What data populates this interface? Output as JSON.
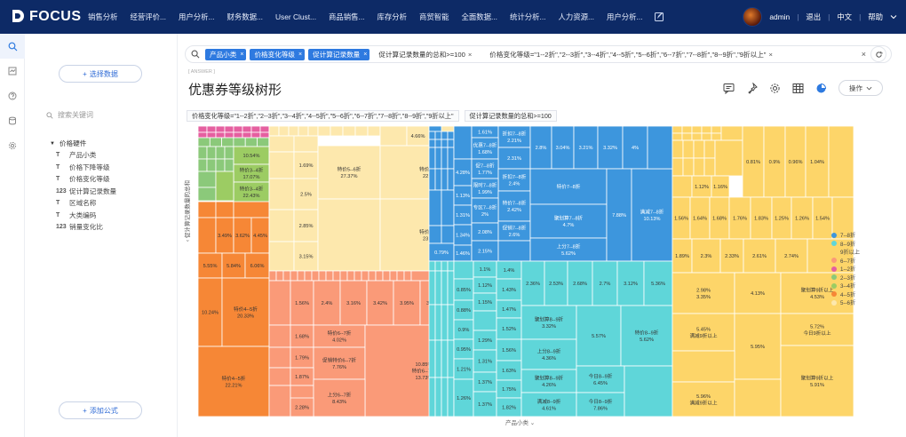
{
  "app": {
    "brand": "FOCUS"
  },
  "nav": {
    "items": [
      "销售分析",
      "经营评价...",
      "用户分析...",
      "财务数据...",
      "User Clust...",
      "商品销售...",
      "库存分析",
      "商贸智能",
      "全面数据...",
      "统计分析...",
      "人力资源...",
      "用户分析..."
    ],
    "user": "admin",
    "logout": "退出",
    "lang": "中文",
    "help": "帮助"
  },
  "sidebar": {
    "pick_data": "选择数据",
    "search_placeholder": "搜索关键词",
    "group": "价格硬件",
    "fields": [
      {
        "type": "T",
        "name": "产品小类"
      },
      {
        "type": "T",
        "name": "价格下降等级"
      },
      {
        "type": "T",
        "name": "价格变化等级"
      },
      {
        "type": "123",
        "name": "促计算记录数量"
      },
      {
        "type": "T",
        "name": "区域名称"
      },
      {
        "type": "T",
        "name": "大类编码"
      },
      {
        "type": "123",
        "name": "销量变化比"
      }
    ],
    "add_formula": "添加公式"
  },
  "filterbar": {
    "chips": [
      "产品小类",
      "价格变化等级",
      "促计算记录数量"
    ],
    "cond1": "促计算记录数量的总和>=100",
    "cond2": "价格变化等级=\"1--2折\",\"2--3折\",\"3--4折\",\"4--5折\",\"5--6折\",\"6--7折\",\"7--8折\",\"8--9折\",\"9折以上\""
  },
  "page": {
    "subtag": "[ ANSWER ]",
    "title": "优惠券等级树形",
    "op_button": "操作"
  },
  "conditions": [
    "价格变化等级=\"1--2折\",\"2--3折\",\"3--4折\",\"4--5折\",\"5--6折\",\"6--7折\",\"7--8折\",\"8--9折\",\"9折以上\"",
    "促计算记录数量的总和>=100"
  ],
  "chart_data": {
    "type": "treemap",
    "y_axis_label": "促计算记录数量的总和",
    "x_axis_label": "产品小类",
    "legend": [
      {
        "name": "7--8折",
        "color": "#3d96dd"
      },
      {
        "name": "8--9折",
        "color": "#5fd6d9"
      },
      {
        "name": "9折以上",
        "color": "#fdd569"
      },
      {
        "name": "6--7折",
        "color": "#fa9a78"
      },
      {
        "name": "1--2折",
        "color": "#e55fa0"
      },
      {
        "name": "2--3折",
        "color": "#8bc97a"
      },
      {
        "name": "3--4折",
        "color": "#9ccc63"
      },
      {
        "name": "4--5折",
        "color": "#f68736"
      },
      {
        "name": "5--6折",
        "color": "#fde8ad"
      }
    ],
    "labels": [
      {
        "text": "10.54%"
      },
      {
        "text": "特价3--4折"
      },
      {
        "text": "17.07%"
      },
      {
        "text": "特价3--4折"
      },
      {
        "text": "22.43%"
      },
      {
        "text": "3.49%"
      },
      {
        "text": "3.62%"
      },
      {
        "text": "4.45%"
      },
      {
        "text": "5.55%"
      },
      {
        "text": "5.84%"
      },
      {
        "text": "6.06%"
      },
      {
        "text": "10.24%"
      },
      {
        "text": "特价4--5折"
      },
      {
        "text": "20.33%"
      },
      {
        "text": "特价4--5折"
      },
      {
        "text": "22.21%"
      },
      {
        "text": "4.66%"
      },
      {
        "text": "4.61%"
      },
      {
        "text": "5.08%"
      },
      {
        "text": "1.69%"
      },
      {
        "text": "2.5%"
      },
      {
        "text": "2.85%"
      },
      {
        "text": "3.15%"
      },
      {
        "text": "特价5--6折"
      },
      {
        "text": "27.37%"
      },
      {
        "text": "特价5--6折"
      },
      {
        "text": "22.40%"
      },
      {
        "text": "特价5--6折"
      },
      {
        "text": "23.86%"
      },
      {
        "text": "1.56%"
      },
      {
        "text": "2.4%"
      },
      {
        "text": "3.16%"
      },
      {
        "text": "3.42%"
      },
      {
        "text": "3.95%"
      },
      {
        "text": "3.96%"
      },
      {
        "text": "1.68%"
      },
      {
        "text": "特价6--7折"
      },
      {
        "text": "4.02%"
      },
      {
        "text": "1.79%"
      },
      {
        "text": "促销特价6--7折"
      },
      {
        "text": "7.76%"
      },
      {
        "text": "1.87%"
      },
      {
        "text": "10.85%"
      },
      {
        "text": "特价6--7折"
      },
      {
        "text": "13.73%"
      },
      {
        "text": "2.13%"
      },
      {
        "text": "上分6--7折"
      },
      {
        "text": "8.43%"
      },
      {
        "text": "2.28%"
      },
      {
        "text": "1.61%"
      },
      {
        "text": "折扣7--8折"
      },
      {
        "text": "2.21%"
      },
      {
        "text": "优惠7--8折"
      },
      {
        "text": "1.68%"
      },
      {
        "text": "2.31%"
      },
      {
        "text": "2.8%"
      },
      {
        "text": "3.04%"
      },
      {
        "text": "3.21%"
      },
      {
        "text": "3.32%"
      },
      {
        "text": "4%"
      },
      {
        "text": "促7--8折"
      },
      {
        "text": "1.77%"
      },
      {
        "text": "折扣7--8折"
      },
      {
        "text": "2.4%"
      },
      {
        "text": "限时7--8折"
      },
      {
        "text": "1.99%"
      },
      {
        "text": "特价7--8折"
      },
      {
        "text": "4.28%"
      },
      {
        "text": "1.13%"
      },
      {
        "text": "1.31%"
      },
      {
        "text": "1.34%"
      },
      {
        "text": "1.46%"
      },
      {
        "text": "0.79%"
      },
      {
        "text": "专区7--8折"
      },
      {
        "text": "2%"
      },
      {
        "text": "2.08%"
      },
      {
        "text": "2.15%"
      },
      {
        "text": "特价7--8折"
      },
      {
        "text": "2.42%"
      },
      {
        "text": "促销7--8折"
      },
      {
        "text": "2.6%"
      },
      {
        "text": "聚划算7--8折"
      },
      {
        "text": "4.7%"
      },
      {
        "text": "上分7--8折"
      },
      {
        "text": "5.62%"
      },
      {
        "text": "7.88%"
      },
      {
        "text": "满减7--8折"
      },
      {
        "text": "10.13%"
      },
      {
        "text": "1.1%"
      },
      {
        "text": "1.4%"
      },
      {
        "text": "1.12%"
      },
      {
        "text": "1.15%"
      },
      {
        "text": "1.43%"
      },
      {
        "text": "0.85%"
      },
      {
        "text": "0.88%"
      },
      {
        "text": "0.9%"
      },
      {
        "text": "0.95%"
      },
      {
        "text": "1.21%"
      },
      {
        "text": "1.26%"
      },
      {
        "text": "1.29%"
      },
      {
        "text": "1.31%"
      },
      {
        "text": "1.37%"
      },
      {
        "text": "1.37%"
      },
      {
        "text": "1.46%"
      },
      {
        "text": "1.47%"
      },
      {
        "text": "1.52%"
      },
      {
        "text": "1.56%"
      },
      {
        "text": "1.63%"
      },
      {
        "text": "1.75%"
      },
      {
        "text": "1.82%"
      },
      {
        "text": "2.36%"
      },
      {
        "text": "2.53%"
      },
      {
        "text": "2.68%"
      },
      {
        "text": "2.7%"
      },
      {
        "text": "3.12%"
      },
      {
        "text": "5.36%"
      },
      {
        "text": "聚划算8--9折"
      },
      {
        "text": "3.32%"
      },
      {
        "text": "上分8--9折"
      },
      {
        "text": "4.36%"
      },
      {
        "text": "聚划算8--9折"
      },
      {
        "text": "4.26%"
      },
      {
        "text": "满减8--9折"
      },
      {
        "text": "4.61%"
      },
      {
        "text": "5.57%"
      },
      {
        "text": "特价8--9折"
      },
      {
        "text": "5.62%"
      },
      {
        "text": "今日8--9折"
      },
      {
        "text": "6.45%"
      },
      {
        "text": "今日8--9折"
      },
      {
        "text": "7.86%"
      },
      {
        "text": "0.81%"
      },
      {
        "text": "0.9%"
      },
      {
        "text": "0.96%"
      },
      {
        "text": "1.04%"
      },
      {
        "text": "1.12%"
      },
      {
        "text": "1.16%"
      },
      {
        "text": "1.25%"
      },
      {
        "text": "1.26%"
      },
      {
        "text": "1.54%"
      },
      {
        "text": "1.56%"
      },
      {
        "text": "1.64%"
      },
      {
        "text": "1.68%"
      },
      {
        "text": "1.76%"
      },
      {
        "text": "1.83%"
      },
      {
        "text": "1.89%"
      },
      {
        "text": "2.3%"
      },
      {
        "text": "2.33%"
      },
      {
        "text": "2.61%"
      },
      {
        "text": "2.74%"
      },
      {
        "text": "2.98%"
      },
      {
        "text": "3.35%"
      },
      {
        "text": "4.13%"
      },
      {
        "text": "聚划算9折以上"
      },
      {
        "text": "4.53%"
      },
      {
        "text": "5.45%"
      },
      {
        "text": "满减9折以上"
      },
      {
        "text": "5.72%"
      },
      {
        "text": "今日9折以上"
      },
      {
        "text": "5.95%"
      },
      {
        "text": "聚划算9折以上"
      },
      {
        "text": "5.91%"
      },
      {
        "text": "5.96%"
      },
      {
        "text": "满减9折以上"
      },
      {
        "text": "9.22%"
      },
      {
        "text": "特价9折以上"
      },
      {
        "text": "5.52%"
      }
    ]
  }
}
